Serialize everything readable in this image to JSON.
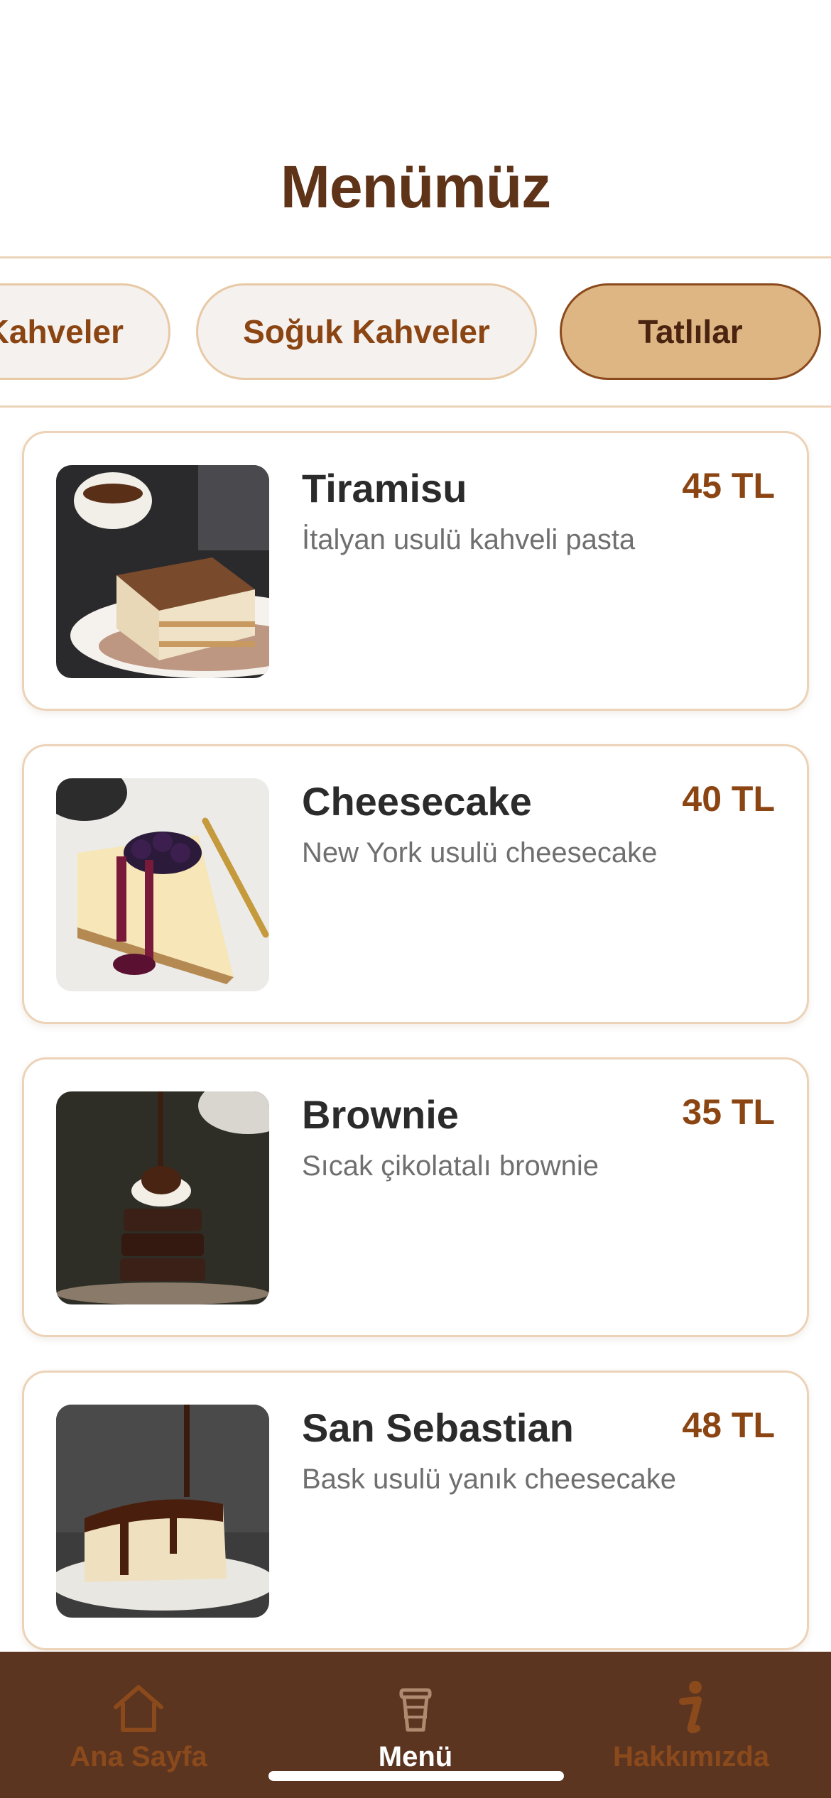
{
  "header": {
    "title": "Menümüz"
  },
  "categories": [
    {
      "label": "Kahveler",
      "selected": false
    },
    {
      "label": "Soğuk Kahveler",
      "selected": false
    },
    {
      "label": "Tatlılar",
      "selected": true
    }
  ],
  "products": [
    {
      "name": "Tiramisu",
      "price": "45 TL",
      "description": "İtalyan usulü kahveli pasta"
    },
    {
      "name": "Cheesecake",
      "price": "40 TL",
      "description": "New York usulü cheesecake"
    },
    {
      "name": "Brownie",
      "price": "35 TL",
      "description": "Sıcak çikolatalı brownie"
    },
    {
      "name": "San Sebastian",
      "price": "48 TL",
      "description": "Bask usulü yanık cheesecake"
    }
  ],
  "tabbar": {
    "items": [
      {
        "label": "Ana Sayfa",
        "icon": "home-icon",
        "active": false
      },
      {
        "label": "Menü",
        "icon": "coffee-cup-icon",
        "active": true
      },
      {
        "label": "Hakkımızda",
        "icon": "info-icon",
        "active": false
      }
    ]
  },
  "colors": {
    "brand_brown": "#5c3520",
    "accent": "#8b4513",
    "selected_chip": "#deb684",
    "border": "#ecd3b8"
  }
}
